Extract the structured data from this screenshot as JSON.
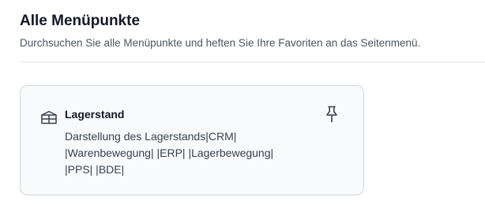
{
  "header": {
    "title": "Alle Menüpunkte",
    "subtitle": "Durchsuchen Sie alle Menüpunkte und heften Sie Ihre Favoriten an das Seitenmenü."
  },
  "cards": [
    {
      "title": "Lagerstand",
      "description_lines": [
        "Darstellung des Lagerstands|CRM|",
        "|Warenbewegung| |ERP| |Lagerbewegung|",
        "|PPS| |BDE|"
      ],
      "icon": "warehouse-icon",
      "action_icon": "pin-icon"
    }
  ]
}
